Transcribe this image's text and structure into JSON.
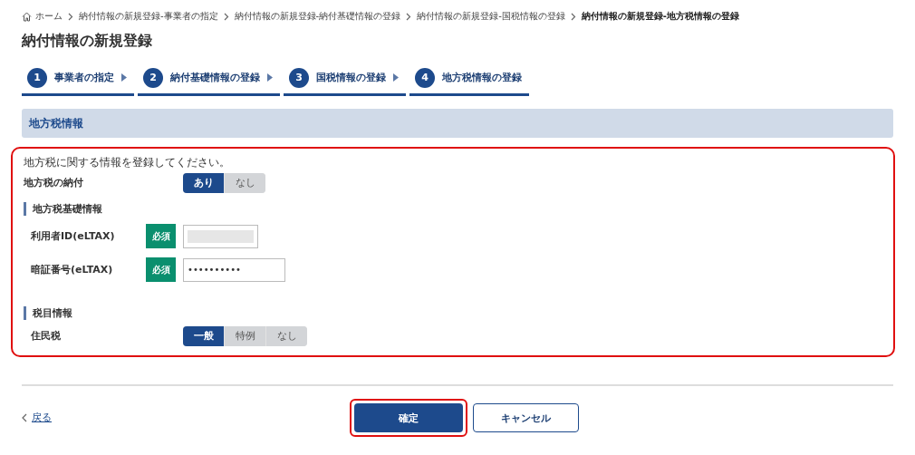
{
  "breadcrumb": [
    {
      "label": "ホーム",
      "kind": "home"
    },
    {
      "label": "納付情報の新規登録-事業者の指定",
      "kind": "link"
    },
    {
      "label": "納付情報の新規登録-納付基礎情報の登録",
      "kind": "link"
    },
    {
      "label": "納付情報の新規登録-国税情報の登録",
      "kind": "link"
    },
    {
      "label": "納付情報の新規登録-地方税情報の登録",
      "kind": "current"
    }
  ],
  "title": "納付情報の新規登録",
  "steps": [
    {
      "number": "1",
      "label": "事業者の指定"
    },
    {
      "number": "2",
      "label": "納付基礎情報の登録"
    },
    {
      "number": "3",
      "label": "国税情報の登録"
    },
    {
      "number": "4",
      "label": "地方税情報の登録"
    }
  ],
  "section": {
    "heading": "地方税情報",
    "highlighted": true,
    "intro": "地方税に関する情報を登録してください。",
    "rows": [
      {
        "kind": "toggle",
        "label": "地方税の納付",
        "options": [
          {
            "label": "あり",
            "selected": true
          },
          {
            "label": "なし",
            "selected": false
          }
        ]
      },
      {
        "kind": "subheading",
        "label": "地方税基礎情報"
      },
      {
        "kind": "field",
        "label": "利用者ID(eLTAX)",
        "badge": "必須",
        "masked": true
      },
      {
        "kind": "field",
        "label": "暗証番号(eLTAX)",
        "badge": "必須",
        "value": "••••••••••"
      },
      {
        "kind": "subheading",
        "label": "税目情報"
      },
      {
        "kind": "toggle",
        "label": "住民税",
        "indent": true,
        "options": [
          {
            "label": "一般",
            "selected": true
          },
          {
            "label": "特例",
            "selected": false
          },
          {
            "label": "なし",
            "selected": false
          }
        ]
      }
    ]
  },
  "footer": {
    "back": "戻る",
    "confirm": {
      "label": "確定",
      "highlighted": true
    },
    "cancel": "キャンセル"
  }
}
